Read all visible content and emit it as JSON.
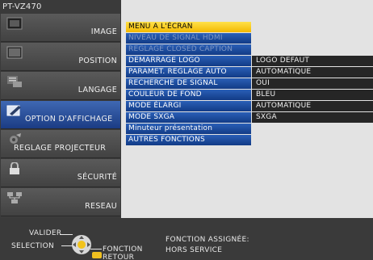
{
  "window": {
    "title": "PT-VZ470"
  },
  "colors": {
    "selected": "#f3b800",
    "menu_bg": "#123b86",
    "active_side": "#1b3c84",
    "value_bg": "#262626"
  },
  "sidebar": {
    "items": [
      {
        "label": "IMAGE",
        "icon": "image-icon"
      },
      {
        "label": "POSITION",
        "icon": "position-icon"
      },
      {
        "label": "LANGAGE",
        "icon": "language-icon"
      },
      {
        "label": "OPTION D'AFFICHAGE",
        "icon": "display-option-icon",
        "active": true
      },
      {
        "label": "REGLAGE PROJECTEUR",
        "icon": "projector-setting-icon"
      },
      {
        "label": "SÉCURITÉ",
        "icon": "lock-icon"
      },
      {
        "label": "RESEAU",
        "icon": "network-icon"
      }
    ]
  },
  "menu": {
    "rows": [
      {
        "label": "MENU A L'ÉCRAN",
        "value": "",
        "state": "selected"
      },
      {
        "label": "NIVEAU DE SIGNAL HDMI",
        "value": "",
        "state": "disabled"
      },
      {
        "label": "REGLAGE CLOSED CAPTION",
        "value": "",
        "state": "disabled"
      },
      {
        "label": "DEMARRAGE LOGO",
        "value": "LOGO DEFAUT",
        "state": "normal"
      },
      {
        "label": "PARAMET. REGLAGE AUTO",
        "value": "AUTOMATIQUE",
        "state": "normal"
      },
      {
        "label": "RECHERCHE DE SIGNAL",
        "value": "OUI",
        "state": "normal"
      },
      {
        "label": "COULEUR DE FOND",
        "value": "BLEU",
        "state": "normal"
      },
      {
        "label": "MODE ÉLARGI",
        "value": "AUTOMATIQUE",
        "state": "normal"
      },
      {
        "label": "MODE SXGA",
        "value": "SXGA",
        "state": "normal"
      },
      {
        "label": "Minuteur présentation",
        "value": "",
        "state": "normal"
      },
      {
        "label": "AUTRES FONCTIONS",
        "value": "",
        "state": "normal"
      }
    ]
  },
  "footer": {
    "valider": "VALIDER",
    "selection": "SELECTION",
    "fonction": "FONCTION",
    "retour": "RETOUR",
    "assigned": "FONCTION ASSIGNÉE:",
    "assigned_value": "HORS SERVICE"
  }
}
